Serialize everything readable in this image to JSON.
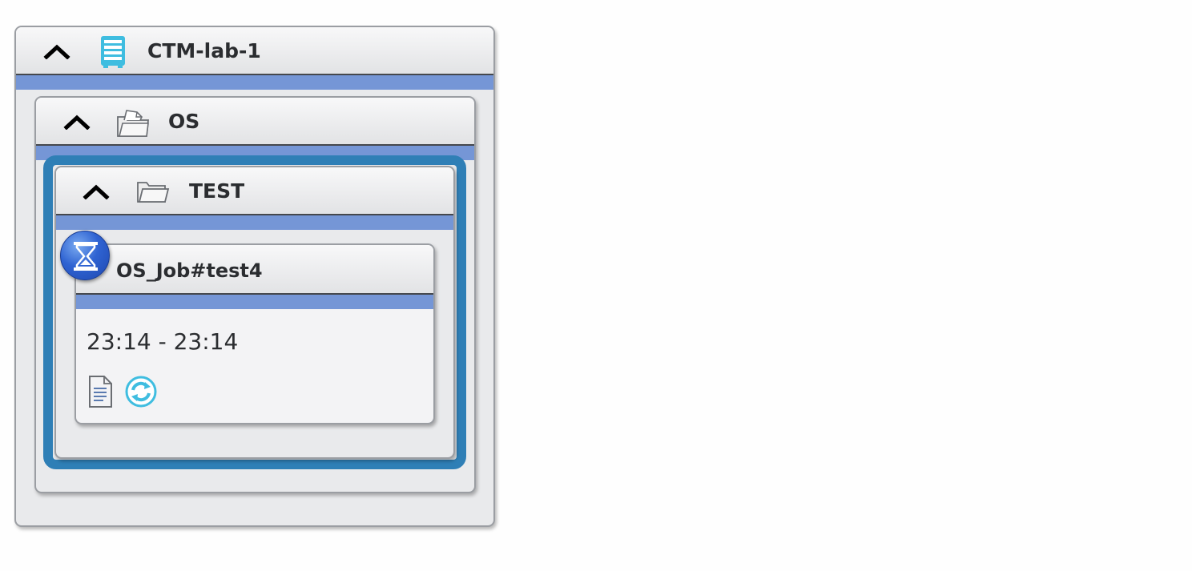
{
  "server": {
    "title": "CTM-lab-1",
    "icon": "server-rack-icon",
    "accent_color": "#7596d6"
  },
  "folder_os": {
    "title": "OS",
    "icon": "folder-documents-icon"
  },
  "folder_test": {
    "title": "TEST",
    "icon": "folder-open-icon",
    "selection_color": "#2f7fb6"
  },
  "job": {
    "title": "OS_Job#test4",
    "time_range": "23:14 - 23:14",
    "status_icon": "hourglass-icon",
    "actions": [
      {
        "name": "output-log",
        "icon": "document-icon"
      },
      {
        "name": "rerun",
        "icon": "refresh-icon"
      }
    ]
  }
}
